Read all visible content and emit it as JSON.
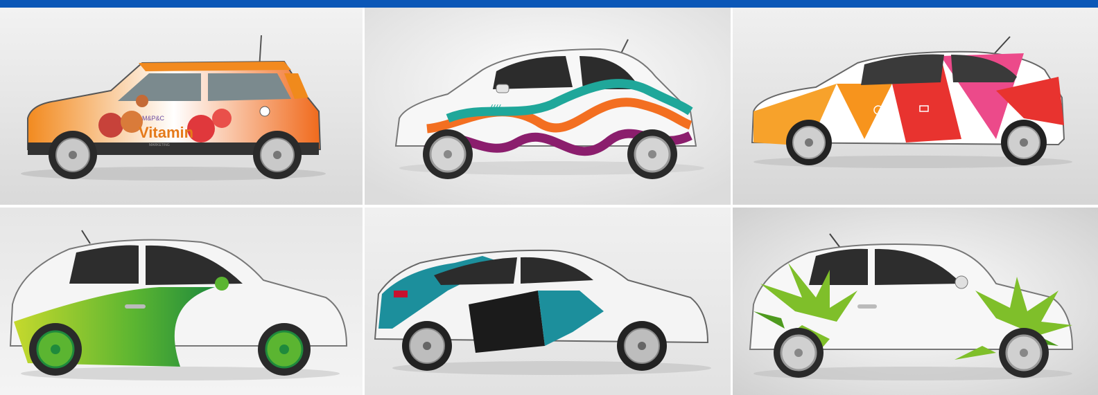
{
  "header": {
    "bar_color": "#0b57b7"
  },
  "gallery": {
    "panels": [
      {
        "id": "p1",
        "subject": "mini hatchback with fruit vitamin livery",
        "logo_text_small": "M&P&C",
        "logo_text_big": "Vitamin",
        "logo_tag": "MARKETING",
        "colors": [
          "#f08a1c",
          "#e83d3d",
          "#ffffff"
        ]
      },
      {
        "id": "p2",
        "subject": "white small car with teal, orange and purple wave stripes",
        "logo_text": "////––",
        "colors": [
          "#1fa79a",
          "#f36f21",
          "#8b1e6d"
        ]
      },
      {
        "id": "p3",
        "subject": "hatchback with red, orange and pink geometric triangles",
        "colors": [
          "#e8332f",
          "#f7941d",
          "#ec4a8a"
        ]
      },
      {
        "id": "p4",
        "subject": "white small car with green and yellow swoosh and green wheels",
        "colors": [
          "#5bb531",
          "#c5d92d",
          "#1f8a3c"
        ]
      },
      {
        "id": "p5",
        "subject": "hatchback with teal and black arrow livery",
        "colors": [
          "#1c8f9c",
          "#1b1b1b",
          "#ffffff"
        ]
      },
      {
        "id": "p6",
        "subject": "white small car with green leaf burst graphics",
        "colors": [
          "#7fbf2a",
          "#4e9a1e",
          "#ffffff"
        ]
      }
    ]
  }
}
